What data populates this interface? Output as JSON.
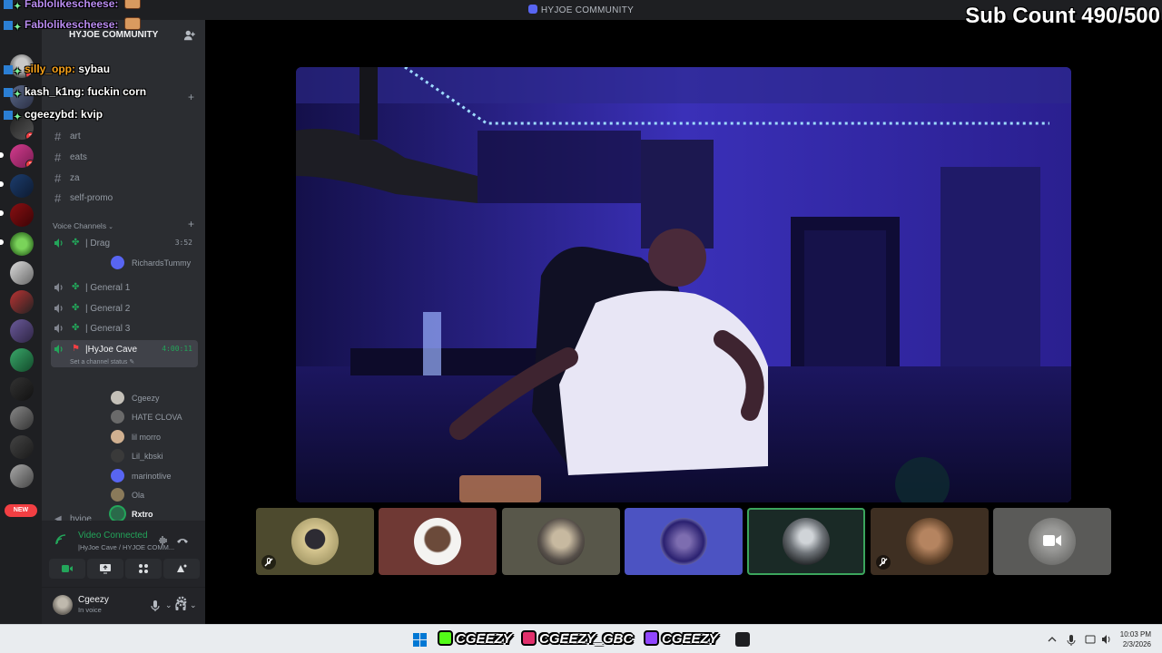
{
  "window": {
    "title": "HYJOE COMMUNITY"
  },
  "overlay": {
    "sub_count": "Sub Count 490/500",
    "chat": [
      {
        "user": "Fablolikescheese",
        "sep": ":",
        "message": "",
        "color": "#b98cf0",
        "emote": true
      },
      {
        "user": "Fablolikescheese",
        "sep": ":",
        "message": "",
        "color": "#b98cf0",
        "emote": true
      },
      {
        "user": "silly_opp",
        "sep": ":",
        "message": "sybau",
        "color": "#f7a21b",
        "emote": false
      },
      {
        "user": "kash_k1ng",
        "sep": ":",
        "message": "fuckin corn",
        "color": "#ffffff",
        "emote": false
      },
      {
        "user": "cgeezybd",
        "sep": ":",
        "message": "kvip",
        "color": "#ffffff",
        "emote": false
      }
    ]
  },
  "server": {
    "name": "HYJOE COMMUNITY",
    "text_channels": [
      {
        "name": "art"
      },
      {
        "name": "eats"
      },
      {
        "name": "za"
      },
      {
        "name": "self-promo"
      }
    ],
    "voice_category": "Voice Channels",
    "voice_channels": [
      {
        "name": "| Drag",
        "time": "3:52"
      },
      {
        "name": "| General 1",
        "time": ""
      },
      {
        "name": "| General 2",
        "time": ""
      },
      {
        "name": "| General 3",
        "time": ""
      },
      {
        "name": "|HyJoe Cave",
        "time": "4:00:11"
      }
    ],
    "drag_user": "RichardsTummy",
    "cave_status": "Set a channel status",
    "cave_users": [
      {
        "name": "Cgeezy",
        "icon": "camera-icon",
        "speaking": false
      },
      {
        "name": "HATE CLOVA",
        "icon": "",
        "speaking": false
      },
      {
        "name": "lil morro",
        "icon": "",
        "speaking": false
      },
      {
        "name": "Lil_kbski",
        "icon": "mic-muted-icon",
        "speaking": false
      },
      {
        "name": "marinotlive",
        "icon": "",
        "speaking": false
      },
      {
        "name": "Ola",
        "icon": "mic-muted-icon",
        "speaking": false
      },
      {
        "name": "Rxtro",
        "icon": "",
        "speaking": true
      }
    ],
    "next_channel": "hyjoe"
  },
  "rail": {
    "new_badge": "NEW",
    "badges": [
      "1",
      "2",
      "2"
    ]
  },
  "voice_panel": {
    "title": "Video Connected",
    "subtitle": "|HyJoe Cave / HYJOE COMM..."
  },
  "user_panel": {
    "name": "Cgeezy",
    "status": "In voice"
  },
  "taskbar": {
    "socials": [
      {
        "label": "CGEEZY",
        "icon": "kick-icon",
        "color": "#53fc18"
      },
      {
        "label": "CGEEZY_GBC",
        "icon": "instagram-icon",
        "color": "#e1306c"
      },
      {
        "label": "CGEEZY",
        "icon": "twitch-icon",
        "color": "#9146ff"
      }
    ],
    "time": "10:03 PM",
    "date": "2/3/2026"
  },
  "colors": {
    "accent": "#5865f2",
    "voice_green": "#23a55a",
    "danger": "#f23f43"
  }
}
